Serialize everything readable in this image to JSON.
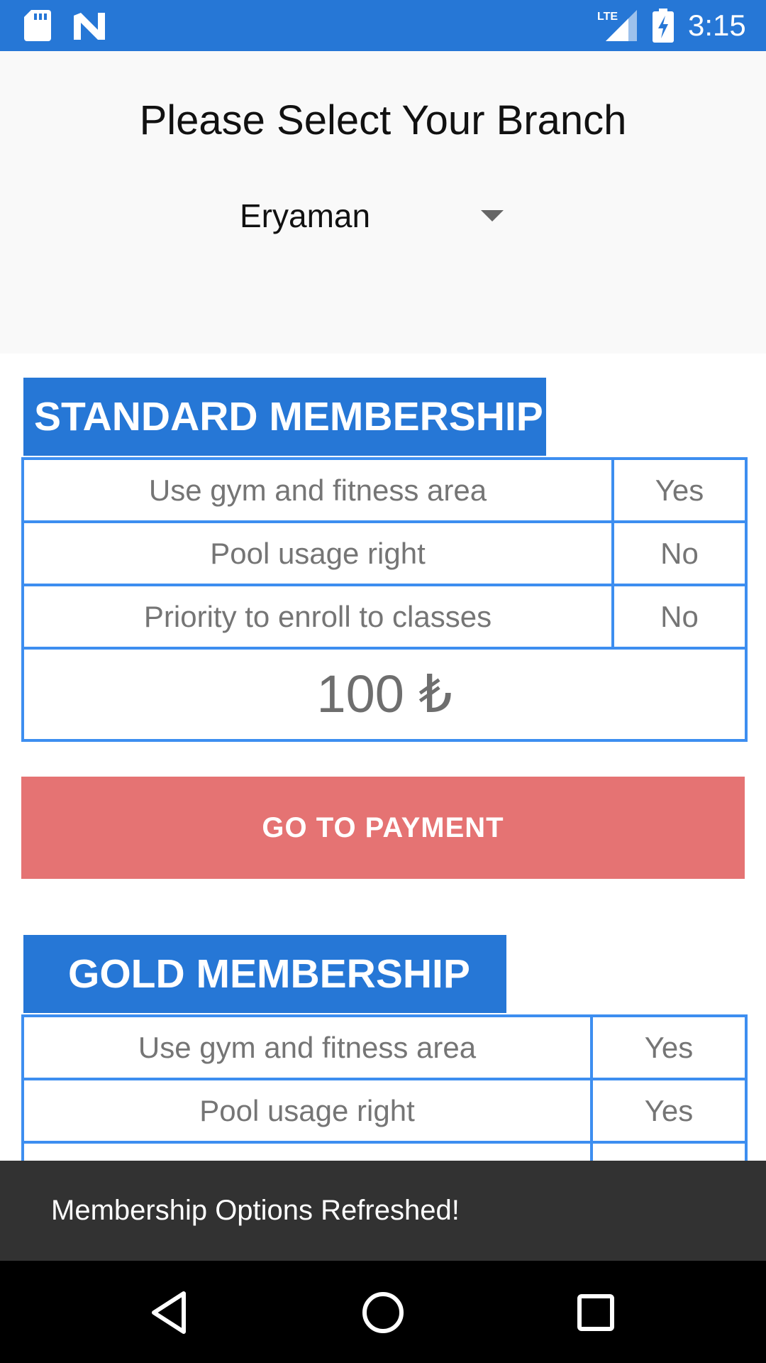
{
  "status_bar": {
    "time": "3:15",
    "network_label": "LTE",
    "icons": [
      "sd-card-icon",
      "n-icon",
      "lte-signal-icon",
      "battery-charging-icon"
    ]
  },
  "header": {
    "title": "Please Select Your Branch",
    "branch_selected": "Eryaman"
  },
  "standard": {
    "title": "STANDARD MEMBERSHIP",
    "features": [
      {
        "label": "Use gym and fitness area",
        "value": "Yes"
      },
      {
        "label": "Pool usage right",
        "value": "No"
      },
      {
        "label": "Priority to enroll to classes",
        "value": "No"
      }
    ],
    "price": "100 ₺",
    "button_label": "GO TO PAYMENT"
  },
  "gold": {
    "title": "GOLD MEMBERSHIP",
    "features": [
      {
        "label": "Use gym and fitness area",
        "value": "Yes"
      },
      {
        "label": "Pool usage right",
        "value": "Yes"
      }
    ]
  },
  "toast": {
    "message": "Membership Options Refreshed!"
  },
  "colors": {
    "primary": "#2677d6",
    "table_border": "#3d8ef0",
    "payment_button": "#e57373",
    "toast_bg": "#323232"
  }
}
